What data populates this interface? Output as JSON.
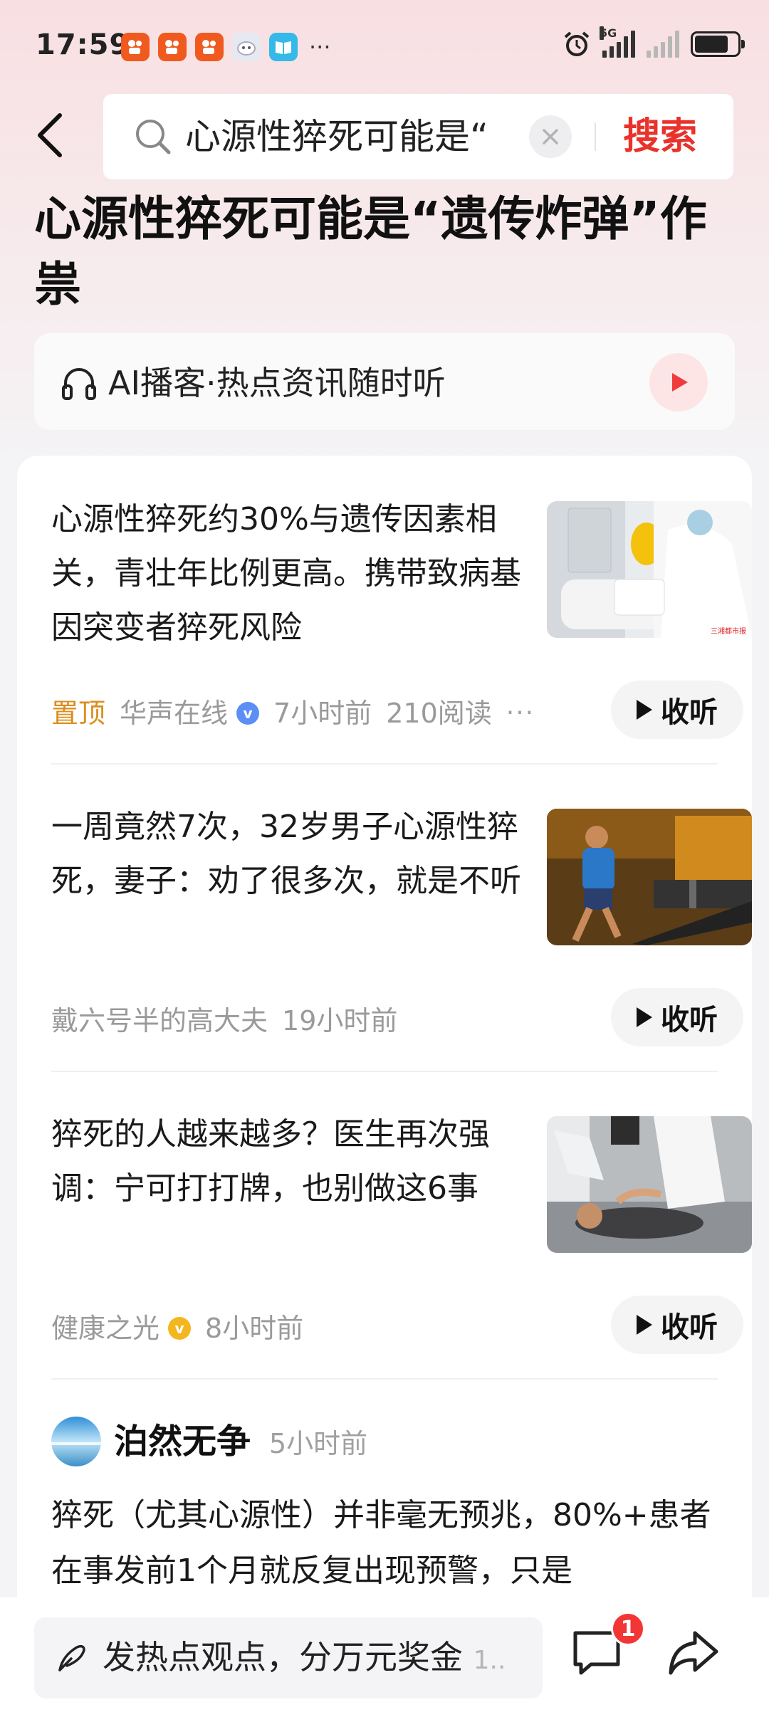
{
  "status_bar": {
    "time": "17:59",
    "app_icon_names": [
      "kuaishou-icon",
      "kuaishou-icon",
      "kuaishou-icon",
      "assistant-icon",
      "reader-icon"
    ],
    "more": "···",
    "network_label": "5G"
  },
  "header": {
    "search_value": "心源性猝死可能是“",
    "search_button": "搜索"
  },
  "hero": {
    "title": "心源性猝死可能是“遗传炸弹”作祟"
  },
  "ai_podcast": {
    "label": "AI播客·热点资讯随时听"
  },
  "news": [
    {
      "title": "心源性猝死约30%与遗传因素相关，青壮年比例更高。携带致病基因突变者猝死风险",
      "pin": "置顶",
      "source": "华声在线",
      "time": "7小时前",
      "reads": "210阅读",
      "more": "···",
      "listen": "收听"
    },
    {
      "title": "一周竟然7次，32岁男子心源性猝死，妻子：劝了很多次，就是不听",
      "source": "戴六号半的高大夫",
      "time": "19小时前",
      "listen": "收听"
    },
    {
      "title": "猝死的人越来越多？医生再次强调：宁可打打牌，也别做这6事",
      "source": "健康之光",
      "time": "8小时前",
      "listen": "收听"
    }
  ],
  "post": {
    "author": "泊然无争",
    "time": "5小时前",
    "text": "猝死（尤其心源性）并非毫无预兆，80%+患者在事发前1个月就反复出现预警，只是"
  },
  "bottom_bar": {
    "comment_placeholder": "发热点观点，分万元奖金",
    "comment_tail": "1..",
    "comment_badge": "1"
  },
  "colors": {
    "accent_red": "#e8322b",
    "pin_orange": "#dc8d1c",
    "badge_red": "#f23535"
  }
}
